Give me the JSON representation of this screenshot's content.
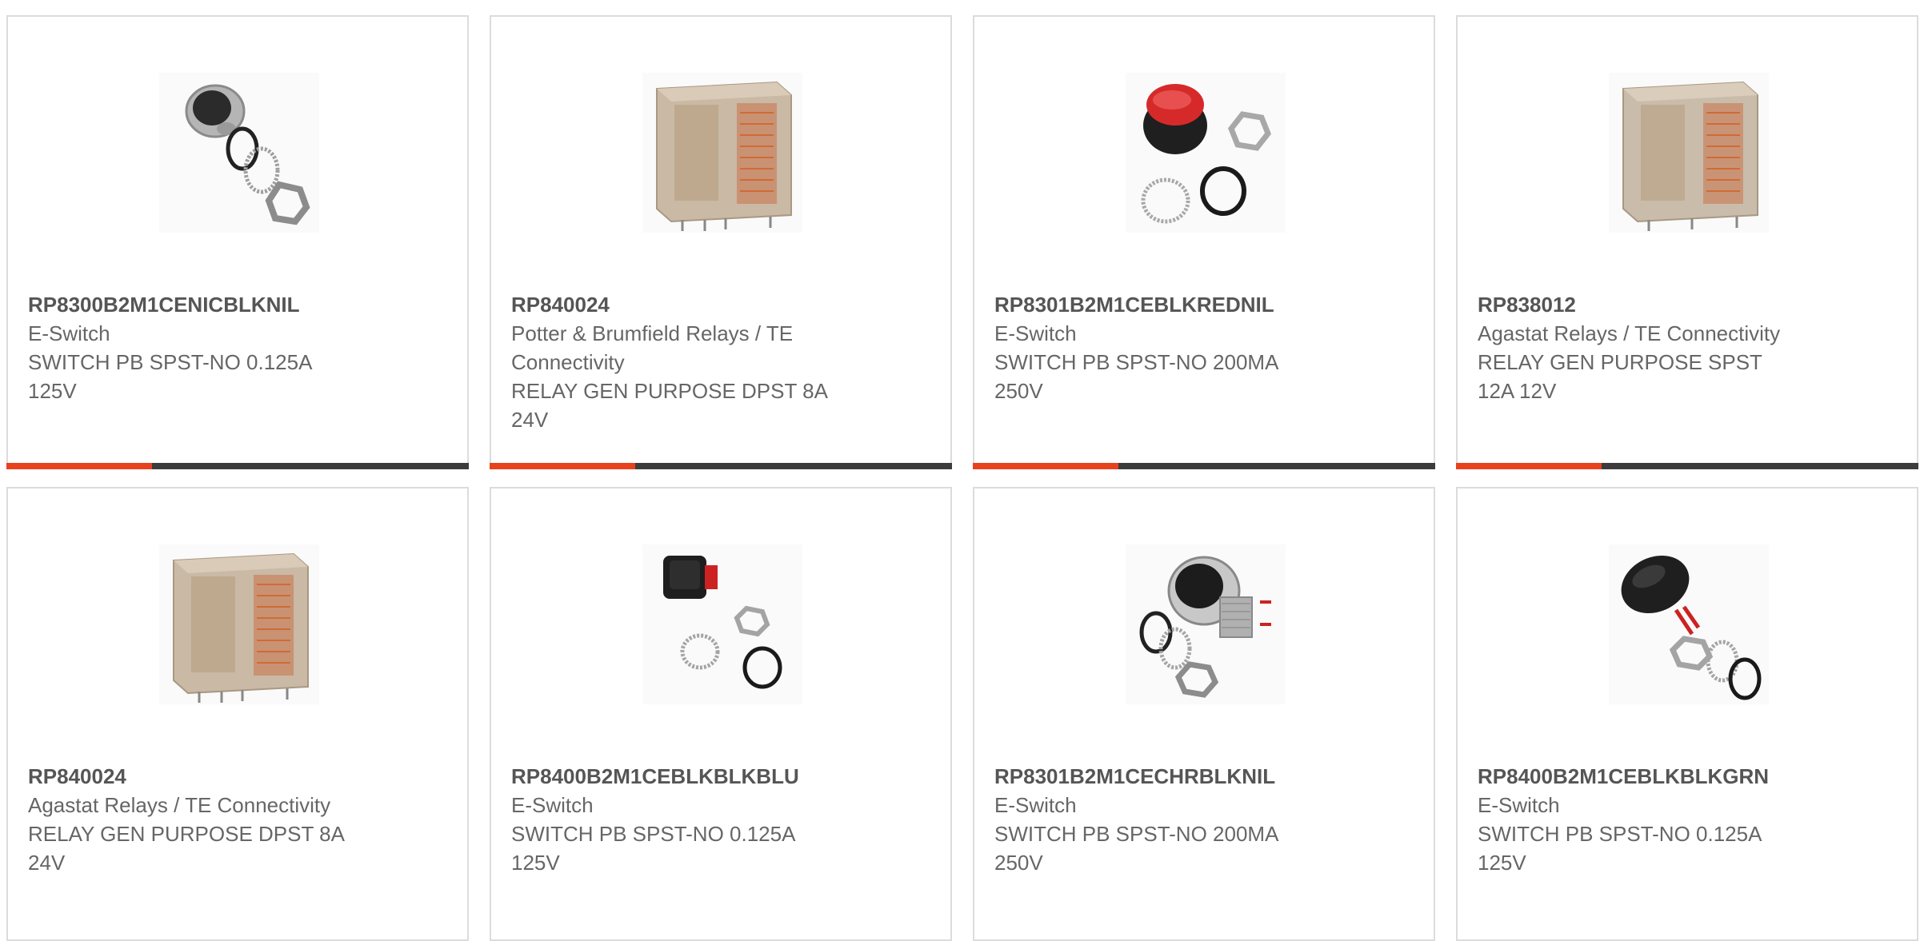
{
  "accent_color": "#e8411e",
  "bar_color": "#3c3c3c",
  "products": [
    {
      "part_number": "RP8300B2M1CENICBLKNIL",
      "manufacturer": "E-Switch",
      "description": "SWITCH PB SPST-NO 0.125A 125V",
      "image_icon": "pushbutton-switch-silver-icon"
    },
    {
      "part_number": "RP840024",
      "manufacturer": "Potter & Brumfield Relays / TE Connectivity",
      "description": "RELAY GEN PURPOSE DPST 8A 24V",
      "image_icon": "relay-icon"
    },
    {
      "part_number": "RP8301B2M1CEBLKREDNIL",
      "manufacturer": "E-Switch",
      "description": "SWITCH PB SPST-NO 200MA 250V",
      "image_icon": "pushbutton-switch-red-icon"
    },
    {
      "part_number": "RP838012",
      "manufacturer": "Agastat Relays / TE Connectivity",
      "description": "RELAY GEN PURPOSE SPST 12A 12V",
      "image_icon": "relay-icon"
    },
    {
      "part_number": "RP840024",
      "manufacturer": "Agastat Relays / TE Connectivity",
      "description": "RELAY GEN PURPOSE DPST 8A 24V",
      "image_icon": "relay-icon"
    },
    {
      "part_number": "RP8400B2M1CEBLKBLKBLU",
      "manufacturer": "E-Switch",
      "description": "SWITCH PB SPST-NO 0.125A 125V",
      "image_icon": "pushbutton-switch-square-icon"
    },
    {
      "part_number": "RP8301B2M1CECHRBLKNIL",
      "manufacturer": "E-Switch",
      "description": "SWITCH PB SPST-NO 200MA 250V",
      "image_icon": "pushbutton-switch-chrome-icon"
    },
    {
      "part_number": "RP8400B2M1CEBLKBLKGRN",
      "manufacturer": "E-Switch",
      "description": "SWITCH PB SPST-NO 0.125A 125V",
      "image_icon": "pushbutton-switch-black-icon"
    }
  ]
}
